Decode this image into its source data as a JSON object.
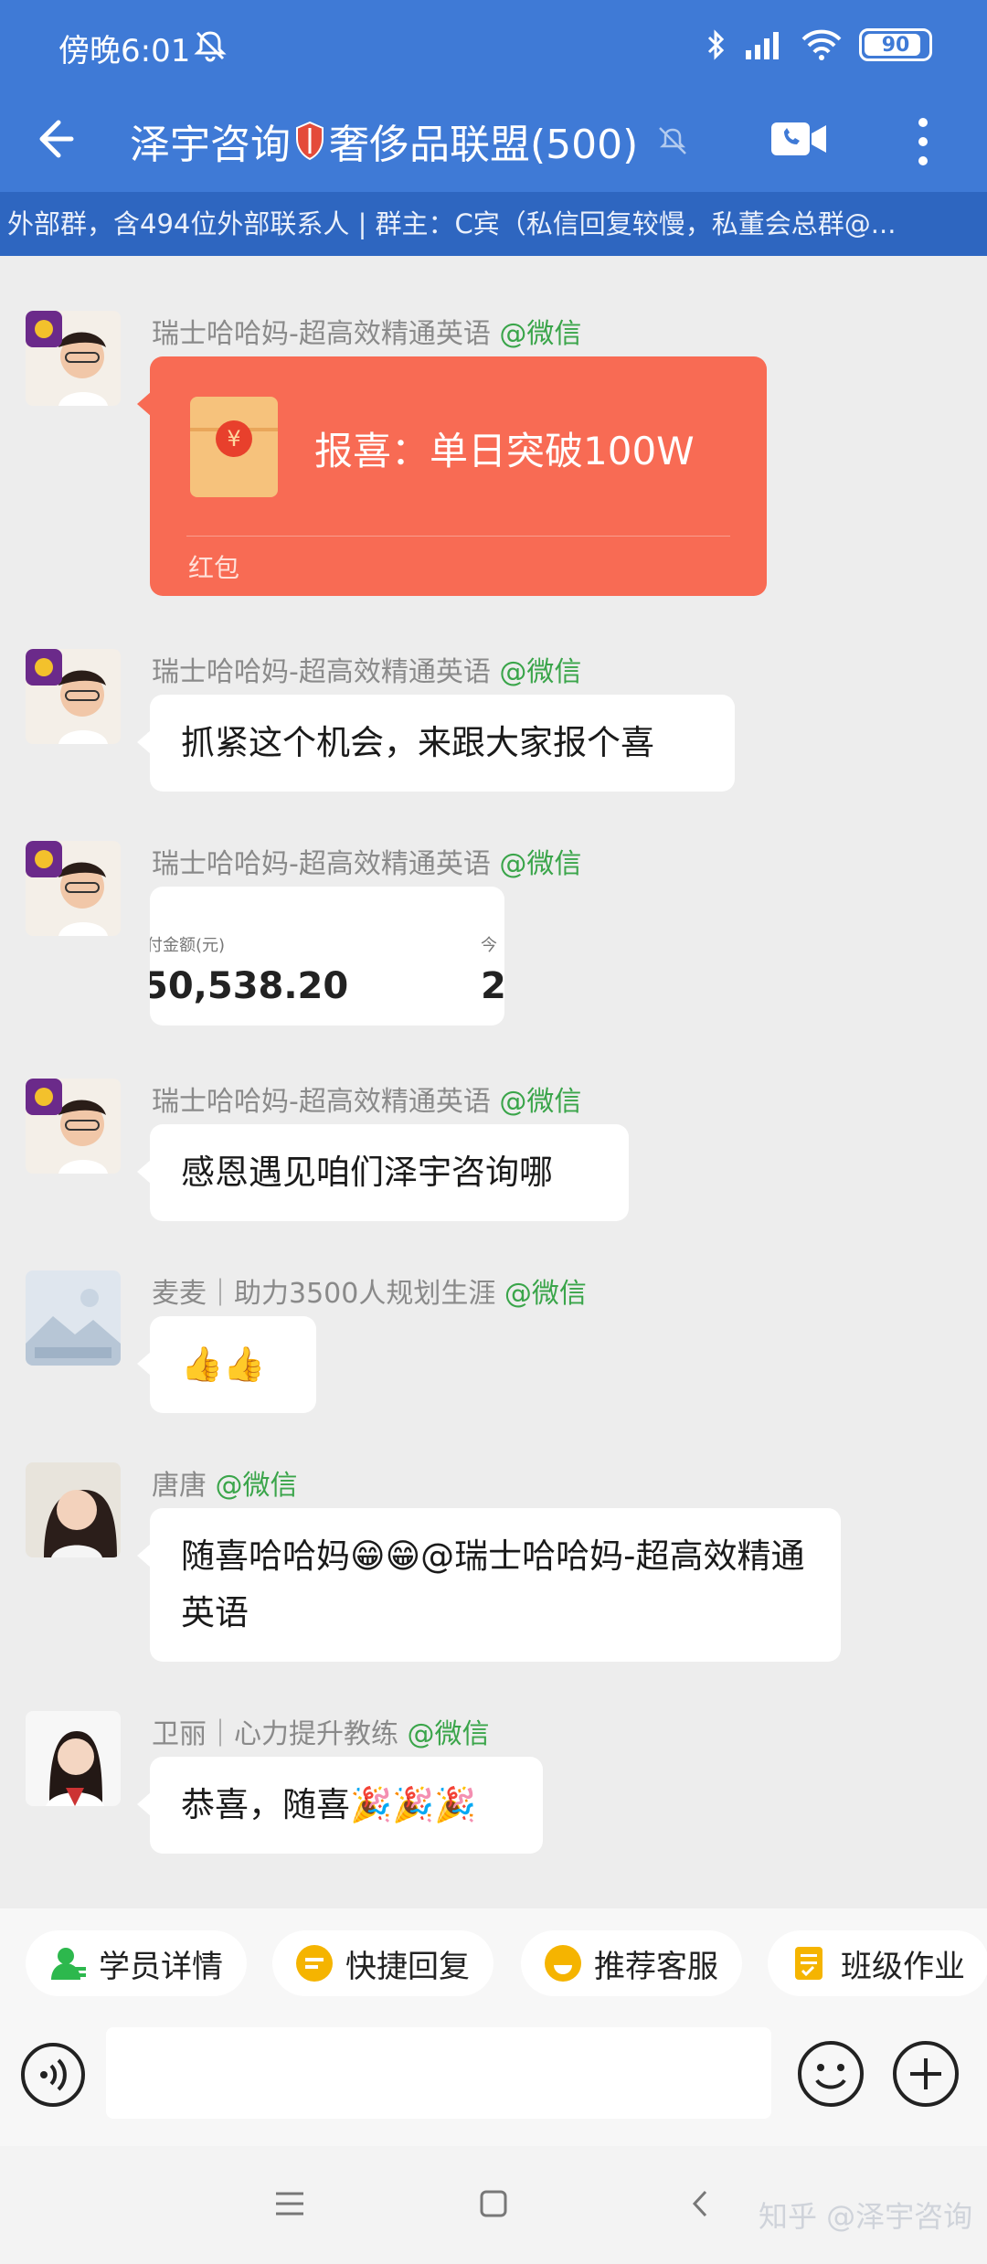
{
  "status_bar": {
    "time": "傍晚6:01",
    "battery": "90",
    "battery_level": 0.9
  },
  "header": {
    "title": "泽宇咨询",
    "title_suffix": "奢侈品联盟(500)"
  },
  "group_info": "外部群，含494位外部联系人 | 群主：C宾（私信回复较慢，私董会总群@...",
  "wechat_tag": "@微信",
  "messages": [
    {
      "sender": "瑞士哈哈妈-超高效精通英语",
      "type": "red_packet",
      "title": "报喜：单日突破100W",
      "footer": "红包"
    },
    {
      "sender": "瑞士哈哈妈-超高效精通英语",
      "type": "text",
      "text": "抓紧这个机会，来跟大家报个喜"
    },
    {
      "sender": "瑞士哈哈妈-超高效精通英语",
      "type": "image",
      "label": "付金额(元)",
      "label2": "今",
      "value": "50,538.20",
      "value2": "2"
    },
    {
      "sender": "瑞士哈哈妈-超高效精通英语",
      "type": "text",
      "text": "感恩遇见咱们泽宇咨询哪"
    },
    {
      "sender": "麦麦｜助力3500人规划生涯",
      "type": "text",
      "text": "👍👍"
    },
    {
      "sender": "唐唐",
      "type": "text",
      "text": "随喜哈哈妈😁😁@瑞士哈哈妈-超高效精通英语"
    },
    {
      "sender": "卫丽｜心力提升教练",
      "type": "text",
      "text": "恭喜，随喜🎉🎉🎉"
    }
  ],
  "quick_actions": [
    {
      "label": "学员详情",
      "icon": "student-icon",
      "color": "#2db84d"
    },
    {
      "label": "快捷回复",
      "icon": "quick-reply-icon",
      "color": "#f5b400"
    },
    {
      "label": "推荐客服",
      "icon": "service-icon",
      "color": "#f5b400"
    },
    {
      "label": "班级作业",
      "icon": "homework-icon",
      "color": "#f5b400"
    }
  ],
  "watermark": "知乎 @泽宇咨询",
  "colors": {
    "primary": "#3f7ad6",
    "info_bar": "#2e66c0",
    "red_packet": "#f86b54",
    "wechat_green": "#3aa54a"
  }
}
